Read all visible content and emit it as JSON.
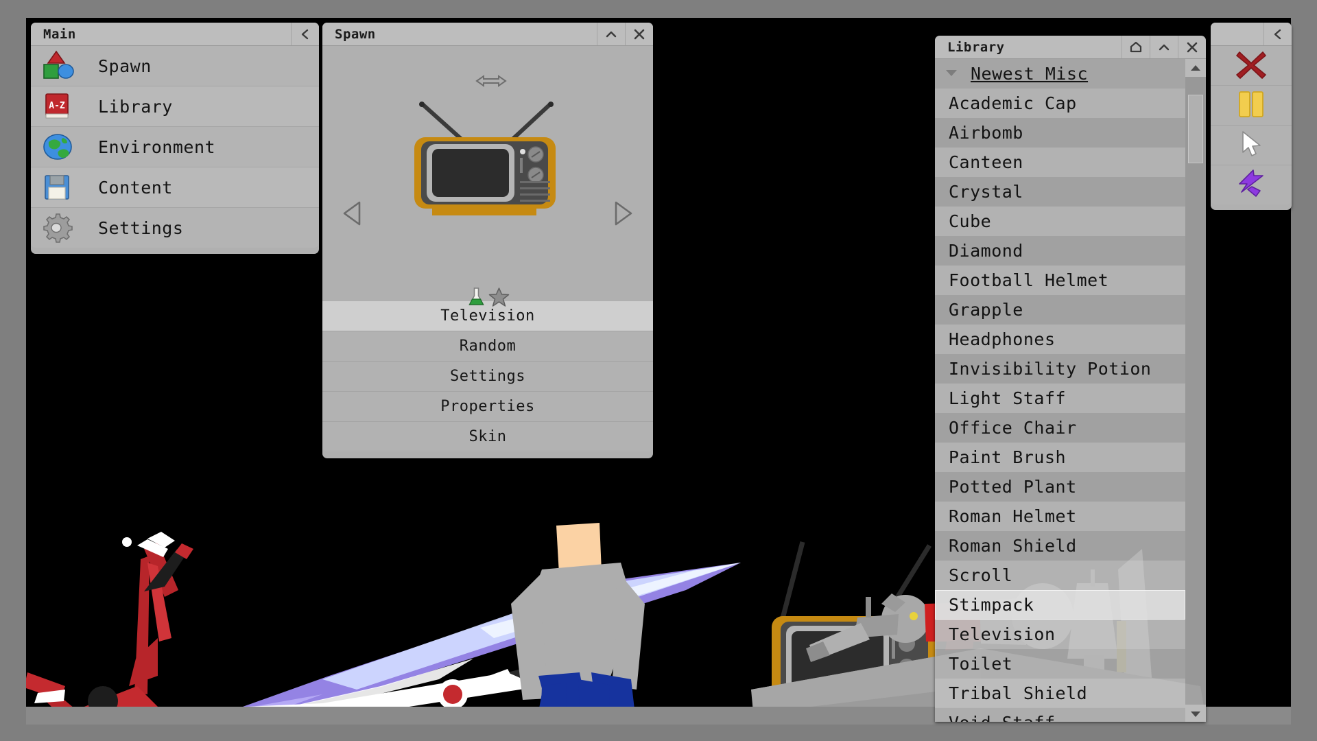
{
  "main_panel": {
    "title": "Main",
    "collapse_icon": "chevron-left-icon",
    "items": [
      {
        "label": "Spawn",
        "icon": "shapes-icon"
      },
      {
        "label": "Library",
        "icon": "book-az-icon"
      },
      {
        "label": "Environment",
        "icon": "globe-icon"
      },
      {
        "label": "Content",
        "icon": "floppy-disk-icon"
      },
      {
        "label": "Settings",
        "icon": "gear-icon"
      }
    ]
  },
  "spawn_panel": {
    "title": "Spawn",
    "collapse_icon": "chevron-up-icon",
    "close_icon": "close-icon",
    "resize_icon": "horizontal-resize-arrow-icon",
    "prev_icon": "triangle-left-icon",
    "next_icon": "triangle-right-icon",
    "preview_item": "Television",
    "badges": [
      "flask-icon",
      "star-icon"
    ],
    "buttons": [
      {
        "label": "Television",
        "state": "active"
      },
      {
        "label": "Random",
        "state": "normal"
      },
      {
        "label": "Settings",
        "state": "normal"
      },
      {
        "label": "Properties",
        "state": "normal"
      },
      {
        "label": "Skin",
        "state": "normal"
      }
    ]
  },
  "library_panel": {
    "title": "Library",
    "home_icon": "home-icon",
    "collapse_icon": "chevron-up-icon",
    "close_icon": "close-icon",
    "group": {
      "label": "Newest Misc",
      "caret_icon": "caret-down-icon",
      "expanded": true
    },
    "scrollbar": {
      "up_icon": "scroll-up-arrow-icon",
      "down_icon": "scroll-down-arrow-icon"
    },
    "selected_item": "Stimpack",
    "items": [
      "Academic Cap",
      "Airbomb",
      "Canteen",
      "Crystal",
      "Cube",
      "Diamond",
      "Football Helmet",
      "Grapple",
      "Headphones",
      "Invisibility Potion",
      "Light Staff",
      "Office Chair",
      "Paint Brush",
      "Potted Plant",
      "Roman Helmet",
      "Roman Shield",
      "Scroll",
      "Stimpack",
      "Television",
      "Toilet",
      "Tribal Shield",
      "Void Staff"
    ]
  },
  "tool_panel": {
    "collapse_icon": "chevron-left-icon",
    "buttons": [
      {
        "name": "delete-tool",
        "icon": "red-x-icon",
        "color": "#a01e22"
      },
      {
        "name": "pause-tool",
        "icon": "yellow-pause-icon",
        "color": "#f2cd4e"
      },
      {
        "name": "cursor-tool",
        "icon": "white-cursor-icon",
        "color": "#ffffff"
      },
      {
        "name": "lightning-tool",
        "icon": "purple-lightning-icon",
        "color": "#8d3ae0"
      }
    ]
  },
  "world": {
    "background_color": "#000000",
    "ground_color": "#8a8a8a",
    "frame_color": "#7f7f7f",
    "objects": [
      "red-scooter",
      "feather-sword",
      "television",
      "desk-lamp",
      "ragdoll-character",
      "office-chair",
      "grey-crate",
      "second-ragdoll"
    ]
  }
}
